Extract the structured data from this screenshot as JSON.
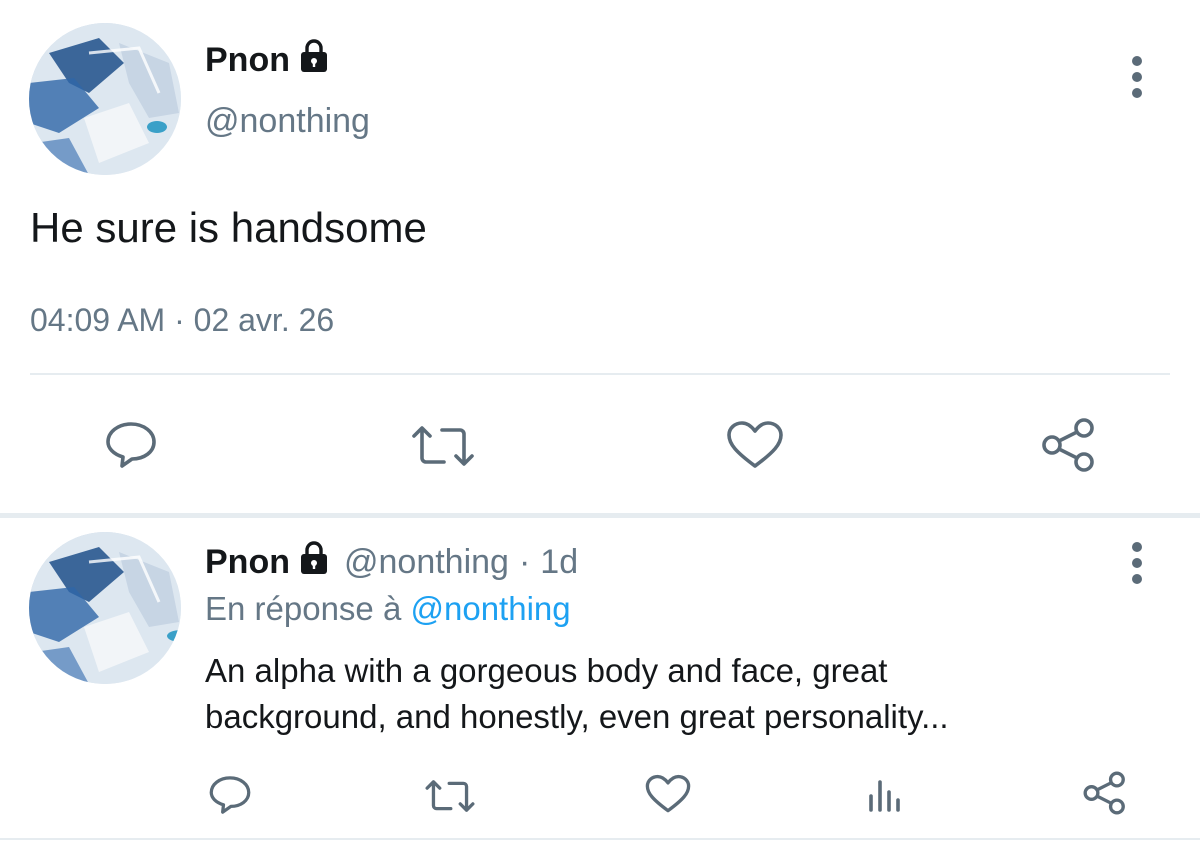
{
  "main_tweet": {
    "display_name": "Pnon",
    "handle": "@nonthing",
    "text": "He sure is handsome",
    "time": "04:09 AM",
    "separator": "·",
    "date": "02 avr. 26",
    "actions": [
      "reply-icon",
      "retweet-icon",
      "like-icon",
      "share-icon"
    ]
  },
  "reply_tweet": {
    "display_name": "Pnon",
    "handle": "@nonthing",
    "dot": "·",
    "age": "1d",
    "reply_prefix": "En réponse à",
    "reply_to": "@nonthing",
    "text_line1": "An alpha with a gorgeous body and face, great",
    "text_line2": "background, and honestly, even great personality...",
    "actions": [
      "reply-icon",
      "retweet-icon",
      "like-icon",
      "analytics-icon",
      "share-icon"
    ]
  },
  "colors": {
    "text": "#14171a",
    "secondary": "#657786",
    "link": "#1da1f2",
    "icon": "#5b6b78",
    "divider": "#e6ecf0"
  }
}
